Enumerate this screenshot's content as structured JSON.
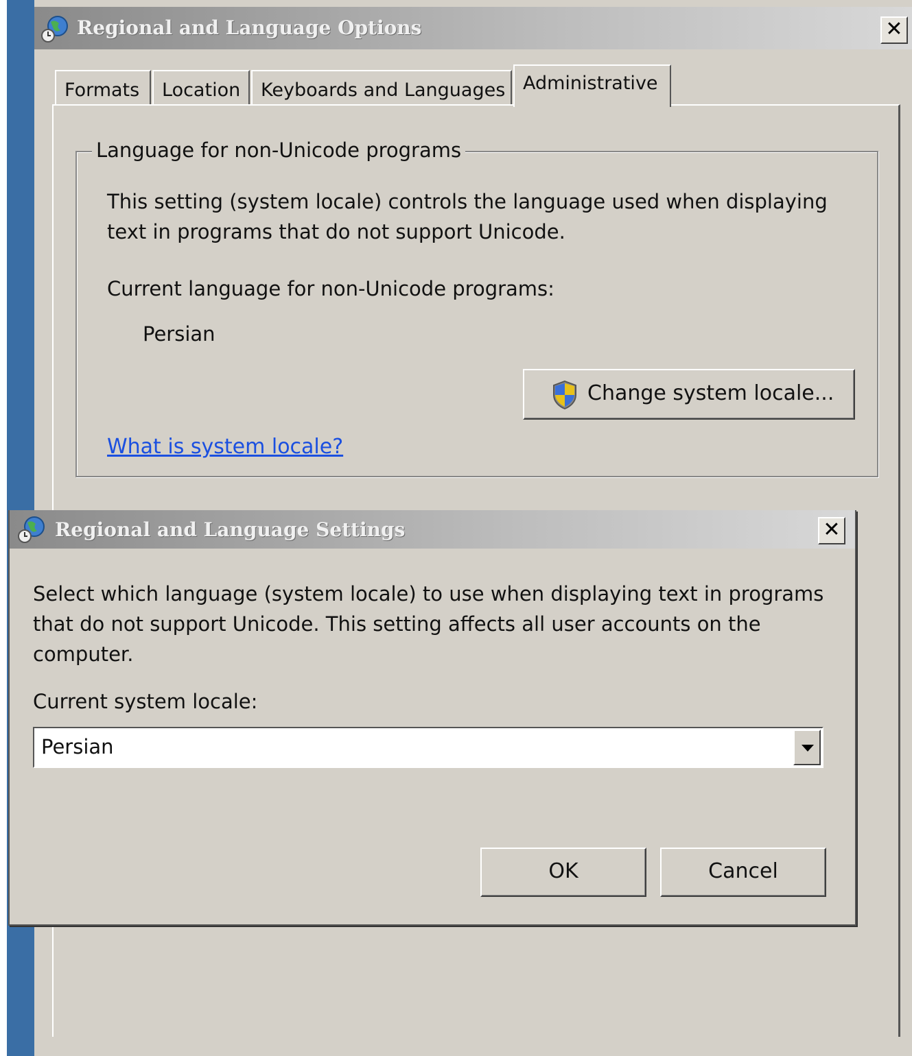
{
  "main_window": {
    "title": "Regional and Language Options",
    "close_label": "✕",
    "tabs": [
      {
        "label": "Formats"
      },
      {
        "label": "Location"
      },
      {
        "label": "Keyboards and Languages"
      },
      {
        "label": "Administrative"
      }
    ],
    "active_tab": "Administrative",
    "group": {
      "legend": "Language for non-Unicode programs",
      "description": "This setting (system locale) controls the language used when displaying text in programs that do not support Unicode.",
      "current_label": "Current language for non-Unicode programs:",
      "current_value": "Persian",
      "change_button_label": "Change system locale...",
      "help_link": "What is system locale?"
    }
  },
  "settings_dialog": {
    "title": "Regional and Language Settings",
    "close_label": "✕",
    "description": "Select which language (system locale) to use when displaying text in programs that do not support Unicode. This setting affects all user accounts on the computer.",
    "locale_label": "Current system locale:",
    "locale_value": "Persian",
    "ok_label": "OK",
    "cancel_label": "Cancel"
  },
  "icons": {
    "window_icon": "globe-clock-icon",
    "shield_icon": "uac-shield-icon",
    "dropdown_icon": "chevron-down-icon"
  }
}
